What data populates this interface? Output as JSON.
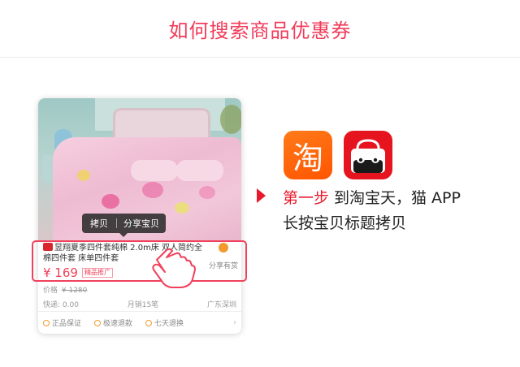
{
  "page": {
    "title": "如何搜索商品优惠券"
  },
  "product_card": {
    "actions": {
      "copy_label": "拷贝",
      "share_label": "分享宝贝"
    },
    "title": "昱翔夏季四件套纯棉 2.0m床 双人简约全棉四件套 床单四件套",
    "share": "分享有赏",
    "price": "¥ 169",
    "promo_tag": "精品推广",
    "orig_price_label": "价格",
    "orig_price": "¥ 1280",
    "shipping": "快递: 0.00",
    "monthly_sales": "月销15笔",
    "location": "广东深圳",
    "services": [
      "正品保证",
      "极速退款",
      "七天退换"
    ]
  },
  "apps": [
    {
      "name": "淘宝",
      "glyph": "淘",
      "icon": "taobao-icon",
      "color": "#ff5500"
    },
    {
      "name": "天猫",
      "icon": "tmall-icon",
      "color": "#e6141e"
    }
  ],
  "instruction": {
    "step_label": "第一步",
    "line1_text": "到淘宝天，猫 APP",
    "line2_text": "长按宝贝标题拷贝"
  },
  "colors": {
    "accent": "#f03c5a",
    "highlight_box": "#f0405a",
    "taobao_orange": "#ff5500",
    "tmall_red": "#e6141e"
  }
}
